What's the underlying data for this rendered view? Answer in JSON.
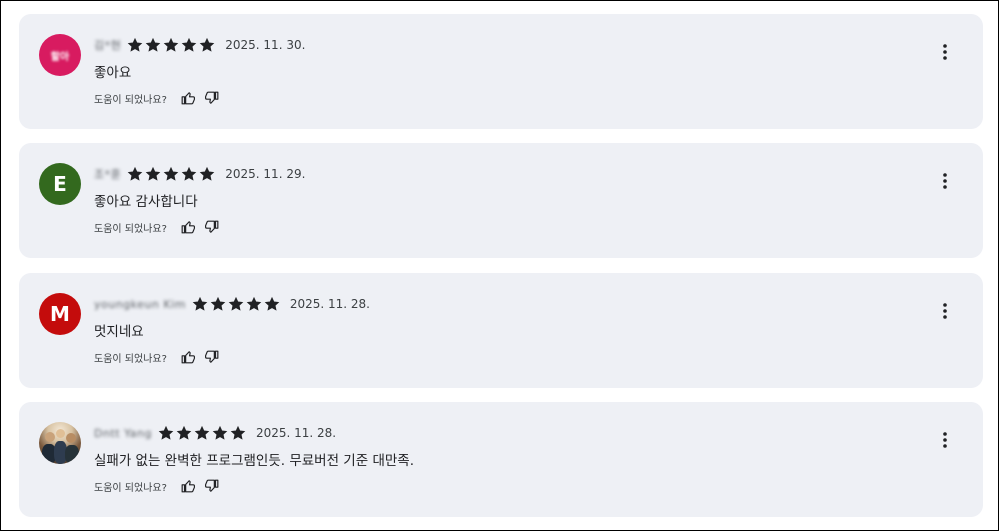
{
  "colors": {
    "card_background": "#eef0f5",
    "star": "#202124",
    "text": "#202124",
    "muted": "#5f6368"
  },
  "helpful_prompt": "도움이 되었나요?",
  "reviews": [
    {
      "name": "김*현",
      "avatar": {
        "kind": "text",
        "label": "할아",
        "color": "#d81b60"
      },
      "rating": 5,
      "date": "2025. 11. 30.",
      "text": "좋아요"
    },
    {
      "name": "조*훈",
      "avatar": {
        "kind": "letter",
        "label": "E",
        "color": "#33691e"
      },
      "rating": 5,
      "date": "2025. 11. 29.",
      "text": "좋아요 감사합니다"
    },
    {
      "name": "youngkeun Kim",
      "avatar": {
        "kind": "letter",
        "label": "M",
        "color": "#c40c0c"
      },
      "rating": 5,
      "date": "2025. 11. 28.",
      "text": "멋지네요"
    },
    {
      "name": "Dntt Yang",
      "avatar": {
        "kind": "photo",
        "label": "",
        "color": "#7b5a3e"
      },
      "rating": 5,
      "date": "2025. 11. 28.",
      "text": "실패가 없는 완벽한 프로그램인듯. 무료버전 기준 대만족."
    }
  ],
  "icons": {
    "star": "star-icon",
    "thumbs_up": "thumbs-up-icon",
    "thumbs_down": "thumbs-down-icon",
    "more": "more-vert-icon"
  }
}
